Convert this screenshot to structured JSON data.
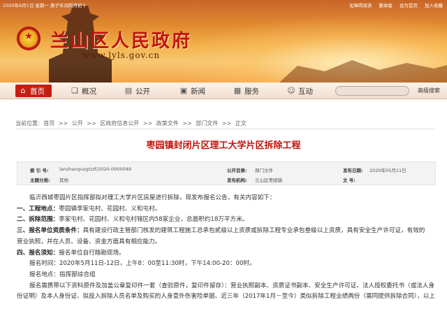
{
  "topbar": {
    "date": "2020年6月1日  星期一  庚子年闰四月初十",
    "links": [
      "无障碍阅读",
      "繁体版",
      "设为首页",
      "加入收藏"
    ]
  },
  "header": {
    "title": "兰山区人民政府",
    "url": "www.lyls.gov.cn"
  },
  "nav": {
    "items": [
      {
        "label": "首页",
        "icon": "home-icon"
      },
      {
        "label": "概况",
        "icon": "book-icon"
      },
      {
        "label": "公开",
        "icon": "document-icon"
      },
      {
        "label": "新闻",
        "icon": "news-icon"
      },
      {
        "label": "服务",
        "icon": "briefcase-icon"
      },
      {
        "label": "互动",
        "icon": "chat-icon"
      }
    ],
    "search_placeholder": "",
    "advanced_search": "高级搜索"
  },
  "breadcrumb": {
    "prefix": "当前位置:",
    "items": [
      "首页",
      "公开",
      "区政府信息公开",
      "政策文件",
      "部门文件",
      "正文"
    ],
    "separator": ">>"
  },
  "article": {
    "title": "枣园镇封闭片区理工大学片区拆除工程",
    "meta": {
      "index_label": "索 引 号:",
      "index_value": "lanshanquzgtzzf/2020-0000049",
      "catalog_label": "公开目录:",
      "catalog_value": "部门文件",
      "date_label": "发布日期:",
      "date_value": "2020年05月11日",
      "category_label": "主题分类:",
      "category_value": "其他",
      "org_label": "发布机构:",
      "org_value": "兰山区枣园镇",
      "docno_label": "文    号:",
      "docno_value": ""
    },
    "paragraphs": {
      "intro": "临沂西城枣园片区指挥部拟对理工大学片区房屋进行拆除，现发布报名公告，有关内容如下：",
      "p1_head": "一、工程地点：",
      "p1_text": "枣园镇李家屯村、花园村、义和屯村。",
      "p2_head": "二、拆除范围：",
      "p2_text": "李家屯村、花园村、义和屯村辖区内58家企业，总面积约18万平方米。",
      "p3_head": "三、报名单位资质条件：",
      "p3_text": "具有建设行政主管部门核发的建筑工程施工总承包贰级以上资质或拆除工程专业承包叁级以上资质，具有安全生产许可证，有效的",
      "p3_cont": "营业执照，并在人员、设备、资金方面具有相应能力。",
      "p4_head": "四、报名须知：",
      "p4_text": "报名单位自行踏勘现场。",
      "p5": "报名时间：2020年5月11日-12日，上午8：00至11:30时，下午14:00-20：00时。",
      "p6": "报名地点：指挥部综合组",
      "p7": "报名需携带以下资料原件及加盖公章复印件一套（查验原件，复印件留存）：营业执照副本、资质证书副本、安全生产许可证、法人授权委托书（或法人身",
      "p8": "份证明）及本人身份证、拟投入拆除人员名单及购买的人身意外伤害险单据、近三年（2017年1月－至今）类似拆除工程业绩两份（需同提供拆除合同），以上"
    }
  }
}
